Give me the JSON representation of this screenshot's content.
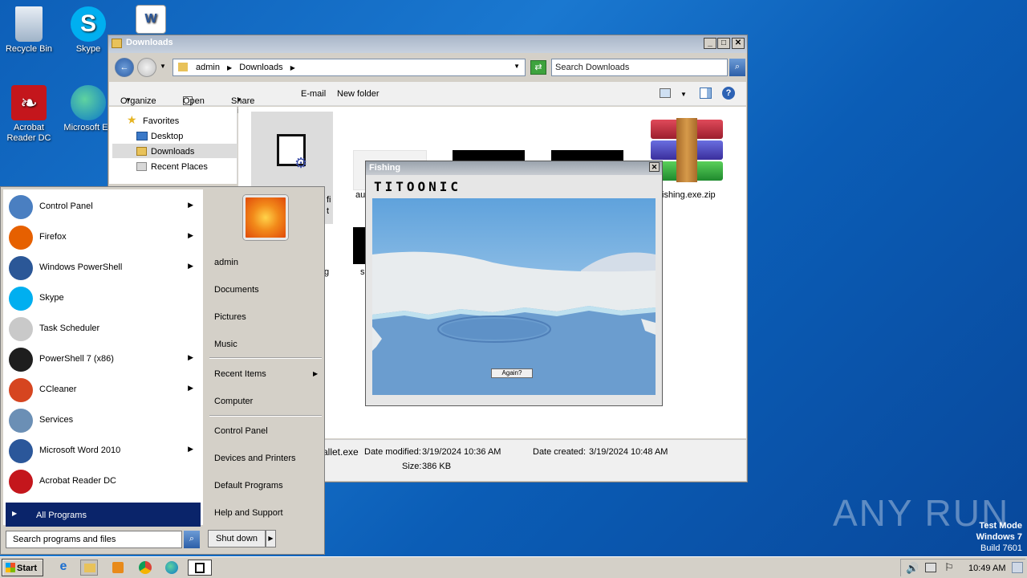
{
  "desktop": {
    "icons": [
      {
        "label": "Recycle Bin",
        "icon": "recycle-bin-icon"
      },
      {
        "label": "Skype",
        "icon": "skype-icon"
      },
      {
        "label": "",
        "icon": "word-document-icon"
      },
      {
        "label": "Acrobat Reader DC",
        "icon": "acrobat-icon"
      },
      {
        "label": "Microsoft Ed",
        "icon": "edge-icon"
      }
    ],
    "watermark": "ANY RUN",
    "test_mode": {
      "line1": "Test Mode",
      "line2": "Windows 7",
      "line3": "Build 7601"
    }
  },
  "explorer": {
    "title": "Downloads",
    "breadcrumb": [
      "admin",
      "Downloads"
    ],
    "search_placeholder": "Search Downloads",
    "toolbar": {
      "organize": "Organize",
      "open": "Open",
      "share_with": "Share with",
      "email": "E-mail",
      "new_folder": "New folder"
    },
    "nav": {
      "favorites": "Favorites",
      "desktop": "Desktop",
      "downloads": "Downloads",
      "recent": "Recent Places"
    },
    "files": {
      "zip_label": "ishing.exe.zip",
      "partial_a": "au",
      "partial_g": "g",
      "partial_s": "s",
      "partial_fi": "fi",
      "partial_t": "t"
    },
    "status": {
      "filename": "allet.exe",
      "date_modified_label": "Date modified:",
      "date_modified": "3/19/2024 10:36 AM",
      "date_created_label": "Date created:",
      "date_created": "3/19/2024 10:48 AM",
      "size_label": "Size:",
      "size": "386 KB"
    }
  },
  "fishing": {
    "title": "Fishing",
    "logo": "TITOONIC",
    "button": "Again?"
  },
  "startmenu": {
    "programs": [
      {
        "label": "Control Panel",
        "arrow": true,
        "color": "#4a7fc1"
      },
      {
        "label": "Firefox",
        "arrow": true,
        "color": "#e66000"
      },
      {
        "label": "Windows PowerShell",
        "arrow": true,
        "color": "#2b5797"
      },
      {
        "label": "Skype",
        "arrow": false,
        "color": "#00aff0"
      },
      {
        "label": "Task Scheduler",
        "arrow": false,
        "color": "#c9c9c9"
      },
      {
        "label": "PowerShell 7 (x86)",
        "arrow": true,
        "color": "#1e1e1e"
      },
      {
        "label": "CCleaner",
        "arrow": true,
        "color": "#d64520"
      },
      {
        "label": "Services",
        "arrow": false,
        "color": "#6b8fb5"
      },
      {
        "label": "Microsoft Word 2010",
        "arrow": true,
        "color": "#2b579a"
      },
      {
        "label": "Acrobat Reader DC",
        "arrow": false,
        "color": "#c4161c"
      }
    ],
    "all_programs": "All Programs",
    "search_placeholder": "Search programs and files",
    "right": {
      "user": "admin",
      "documents": "Documents",
      "pictures": "Pictures",
      "music": "Music",
      "recent_items": "Recent Items",
      "computer": "Computer",
      "control_panel": "Control Panel",
      "devices": "Devices and Printers",
      "default_programs": "Default Programs",
      "help": "Help and Support"
    },
    "shutdown": "Shut down"
  },
  "taskbar": {
    "start": "Start",
    "clock": "10:49 AM"
  }
}
